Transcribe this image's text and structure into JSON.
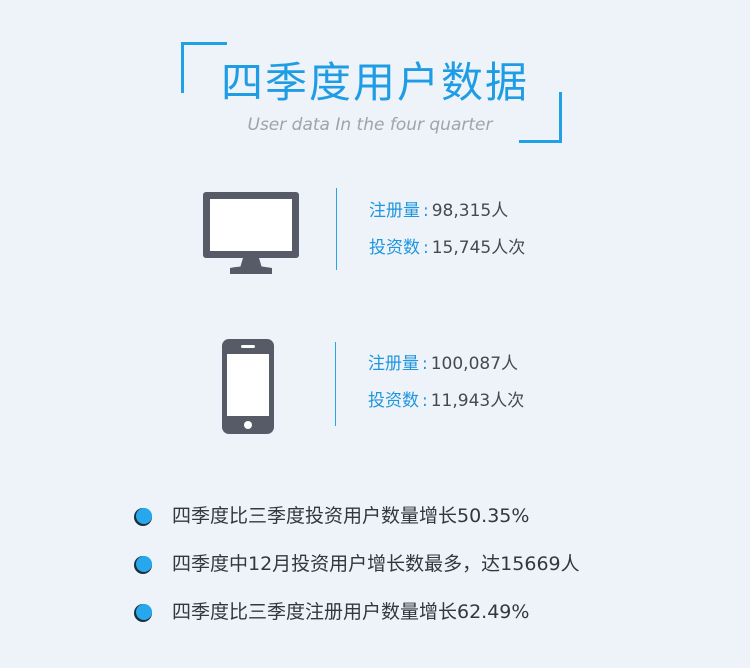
{
  "header": {
    "title": "四季度用户数据",
    "subtitle": "User data In the four quarter"
  },
  "pc": {
    "icon": "desktop-monitor-icon",
    "register_label": "注册量",
    "register_value": "98,315人",
    "invest_label": "投资数",
    "invest_value": "15,745人次"
  },
  "mobile": {
    "icon": "smartphone-icon",
    "register_label": "注册量",
    "register_value": "100,087人",
    "invest_label": "投资数",
    "invest_value": "11,943人次"
  },
  "separator": ":",
  "bullets": [
    "四季度比三季度投资用户数量增长50.35%",
    "四季度中12月投资用户增长数最多，达15669人",
    "四季度比三季度注册用户数量增长62.49%"
  ],
  "colors": {
    "accent": "#1f9de4",
    "icon": "#565b67",
    "background": "#edf3f8"
  }
}
